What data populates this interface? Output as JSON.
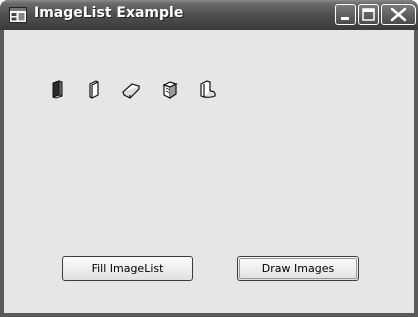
{
  "window": {
    "title": "ImageList Example",
    "app_icon": "window-app-icon",
    "controls": {
      "minimize_icon": "minimize-icon",
      "maximize_icon": "maximize-icon",
      "close_icon": "close-icon"
    }
  },
  "image_list": {
    "icons": [
      "book-closed-icon",
      "book-open-icon",
      "book-tilted-icon",
      "book-stack-icon",
      "book-curled-icon"
    ]
  },
  "buttons": {
    "fill_label": "Fill ImageList",
    "draw_label": "Draw Images"
  },
  "colors": {
    "client_background": "#e6e6e6",
    "titlebar": "#4e4e4e",
    "title_text": "#ffffff"
  }
}
